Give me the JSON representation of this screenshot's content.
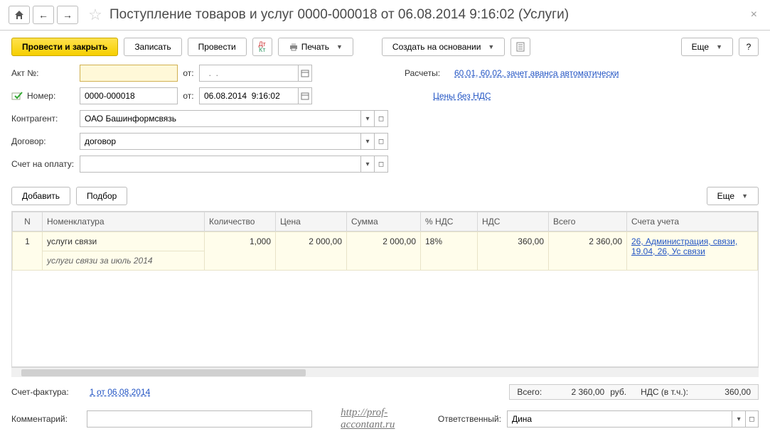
{
  "header": {
    "title": "Поступление товаров и услуг 0000-000018 от 06.08.2014 9:16:02 (Услуги)"
  },
  "toolbar": {
    "post_close": "Провести и закрыть",
    "save": "Записать",
    "post": "Провести",
    "print": "Печать",
    "create_based": "Создать на основании",
    "more": "Еще",
    "help": "?"
  },
  "form": {
    "act_label": "Акт №:",
    "act_from": "от:",
    "act_date_placeholder": "  .  .",
    "number_label": "Номер:",
    "number_value": "0000-000018",
    "number_from": "от:",
    "date_value": "06.08.2014  9:16:02",
    "contractor_label": "Контрагент:",
    "contractor_value": "ОАО Башинформсвязь",
    "contract_label": "Договор:",
    "contract_value": "договор",
    "invoice_label": "Счет на оплату:",
    "invoice_value": "",
    "settlements_label": "Расчеты:",
    "settlements_link": "60.01, 60.02, зачет аванса автоматически",
    "prices_link": "Цены без НДС"
  },
  "table_toolbar": {
    "add": "Добавить",
    "pick": "Подбор",
    "more": "Еще"
  },
  "table": {
    "headers": {
      "n": "N",
      "item": "Номенклатура",
      "qty": "Количество",
      "price": "Цена",
      "sum": "Сумма",
      "vat_pct": "% НДС",
      "vat": "НДС",
      "total": "Всего",
      "accounts": "Счета учета"
    },
    "rows": [
      {
        "n": "1",
        "item": "услуги связи",
        "sub": "услуги связи за июль 2014",
        "qty": "1,000",
        "price": "2 000,00",
        "sum": "2 000,00",
        "vat_pct": "18%",
        "vat": "360,00",
        "total": "2 360,00",
        "accounts": "26, Администрация, связи, 19.04, 26, Ус связи"
      }
    ]
  },
  "footer": {
    "invoice_fact_label": "Счет-фактура:",
    "invoice_fact_link": "1 от 06.08.2014",
    "total_label": "Всего:",
    "total_value": "2 360,00",
    "currency": "руб.",
    "vat_label": "НДС (в т.ч.):",
    "vat_value": "360,00",
    "comment_label": "Комментарий:",
    "comment_value": "",
    "responsible_label": "Ответственный:",
    "responsible_value": "Дина",
    "watermark": "http://prof-accontant.ru"
  }
}
